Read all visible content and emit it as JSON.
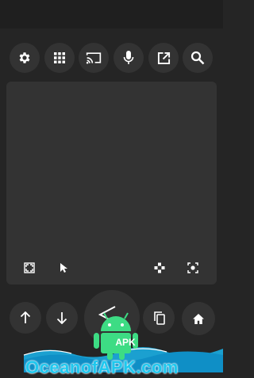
{
  "top_toolbar": {
    "buttons": [
      {
        "name": "settings",
        "icon": "gear-icon"
      },
      {
        "name": "apps",
        "icon": "grid-icon"
      },
      {
        "name": "cast",
        "icon": "cast-icon"
      },
      {
        "name": "voice",
        "icon": "microphone-icon"
      },
      {
        "name": "open-external",
        "icon": "open-in-new-icon"
      },
      {
        "name": "search",
        "icon": "search-icon"
      }
    ]
  },
  "touchpad": {
    "tools": [
      "fullscreen-icon",
      "pointer-icon",
      "dpad-icon",
      "screenshot-icon"
    ]
  },
  "bottom_controls": {
    "buttons": [
      "arrow-up-icon",
      "arrow-down-icon",
      "back-icon",
      "copy-icon",
      "home-icon"
    ]
  },
  "watermark": {
    "badge": "APK",
    "site": "OceanofAPK.com"
  },
  "colors": {
    "background": "#252525",
    "button": "#333333",
    "icon": "#ffffff",
    "watermark_blue": "#1ec8ee",
    "android_green": "#3ddc84"
  }
}
